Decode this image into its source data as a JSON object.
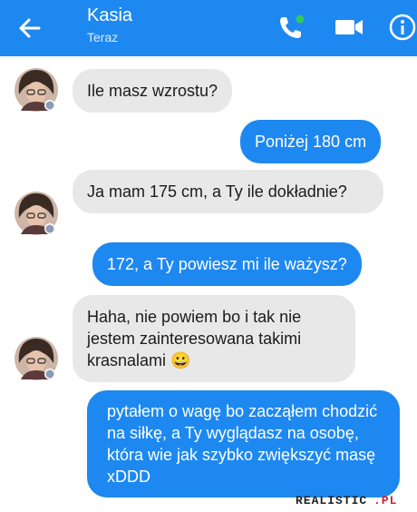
{
  "header": {
    "contact_name": "Kasia",
    "status": "Teraz"
  },
  "messages": [
    {
      "from": "contact",
      "text": "Ile masz wzrostu?"
    },
    {
      "from": "me",
      "text": "Poniżej 180 cm"
    },
    {
      "from": "contact",
      "text": "Ja mam 175 cm, a Ty ile dokładnie?"
    },
    {
      "from": "me",
      "text": "172, a Ty powiesz mi ile ważysz?"
    },
    {
      "from": "contact",
      "text": "Haha, nie powiem bo i tak nie jestem zainteresowana takimi krasnalami 😀"
    },
    {
      "from": "me",
      "text": "pytałem o wagę bo zacząłem chodzić na siłkę, a Ty wyglądasz na osobę, która wie jak szybko zwiększyć masę xDDD"
    }
  ],
  "watermark": "REALISTIC.PL",
  "colors": {
    "header": "#1e88f1",
    "outgoing_bubble": "#1e88f1",
    "incoming_bubble": "#e8e8e8",
    "call_dot": "#34c759"
  },
  "icons": {
    "back": "back-arrow-icon",
    "call": "phone-call-icon",
    "video": "video-camera-icon",
    "info": "info-icon",
    "avatar_badge": "facebook-badge-icon"
  }
}
